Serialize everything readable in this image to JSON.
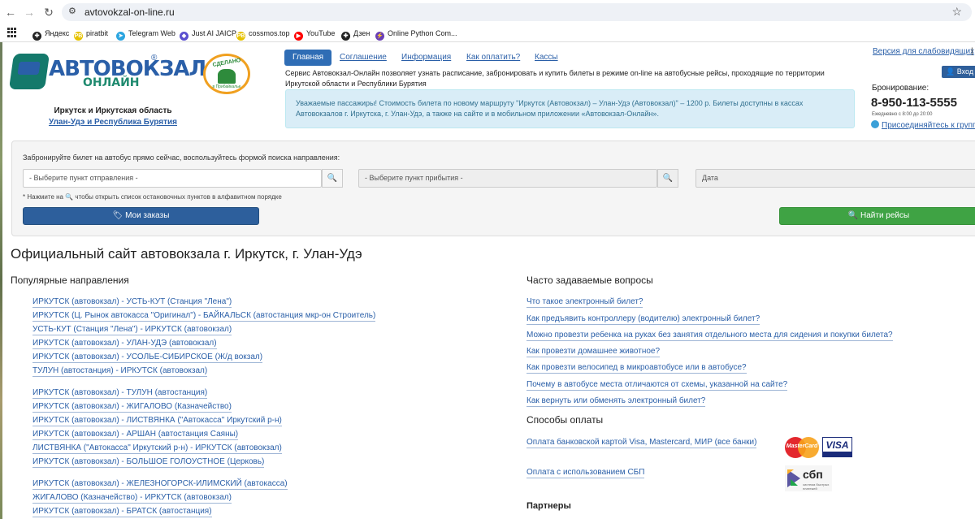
{
  "browser": {
    "url": "avtovokzal-on-line.ru",
    "bookmarks": [
      {
        "label": "Яндекс",
        "icon": "yandex-icon",
        "color": "#222222",
        "glyph": "✚"
      },
      {
        "label": "piratbit",
        "icon": "piratbit-icon",
        "color": "#e6c200",
        "glyph": "PB"
      },
      {
        "label": "Telegram Web",
        "icon": "telegram-icon",
        "color": "#2ca5e0",
        "glyph": "➤"
      },
      {
        "label": "Just AI JAICP",
        "icon": "jaicp-icon",
        "color": "#5a4fcf",
        "glyph": "◆"
      },
      {
        "label": "cossmos.top",
        "icon": "cossmos-icon",
        "color": "#e6c200",
        "glyph": "PB"
      },
      {
        "label": "YouTube",
        "icon": "youtube-icon",
        "color": "#ff0000",
        "glyph": "▶"
      },
      {
        "label": "Дзен",
        "icon": "dzen-icon",
        "color": "#222222",
        "glyph": "✚"
      },
      {
        "label": "Online Python Com...",
        "icon": "python-icon",
        "color": "#6a3fb5",
        "glyph": "⚡"
      }
    ]
  },
  "header": {
    "logo_line1": "АВТОВОКЗАЛ",
    "logo_line2": "ОНЛАЙН",
    "logo_reg": "®",
    "region_title": "Иркутск и Иркутская область",
    "region_link": "Улан-Удэ и Республика Бурятия",
    "badge_top": "СДЕЛАНО",
    "badge_bottom": "в Прибайкалье",
    "tabs": [
      "Главная",
      "Соглашение",
      "Информация",
      "Как оплатить?",
      "Кассы"
    ],
    "intro": "Сервис Автовокзал-Онлайн позволяет узнать расписание, забронировать и купить билеты в режиме on-line на автобусные рейсы, проходящие по территории Иркутской области и Республики Бурятия",
    "notice": "Уважаемые пассажиры! Стоимость билета по новому маршруту \"Иркутск (Автовокзал) – Улан-Удэ (Автовокзал)\" – 1200 р. Билеты доступны в кассах Автовокзалов г. Иркутска, г. Улан-Удэ, а также на сайте и в мобильном приложении «Автовокзал-Онлайн».",
    "low_vision_link": "Версия для слабовидящих",
    "separator": "|",
    "login": "Вход д",
    "booking_label": "Бронирование:",
    "phone": "8-950-113-5555",
    "hours": "Ежедневно с 8:00 до 20:00",
    "join_link": "Присоединяйтесь к группе"
  },
  "search": {
    "hint": "Забронируйте билет на автобус прямо сейчас, воспользуйтесь формой поиска направления:",
    "from_placeholder": "- Выберите пункт отправления -",
    "to_placeholder": "- Выберите пункт прибытия -",
    "date_placeholder": "Дата",
    "note": "* Нажмите на 🔍 чтобы открыть список остановочных пунктов в алфавитном порядке",
    "orders_button": "🏷 Мои заказы",
    "find_button": "🔍 Найти рейсы"
  },
  "main": {
    "title": "Официальный сайт автовокзала г. Иркутск, г. Улан-Удэ",
    "popular_heading": "Популярные направления",
    "routes": [
      "ИРКУТСК (автовокзал) - УСТЬ-КУТ (Станция \"Лена\")",
      "ИРКУТСК (Ц. Рынок автокасса \"Оригинал\") - БАЙКАЛЬСК (автостанция мкр-он Строитель)",
      "УСТЬ-КУТ (Станция \"Лена\") - ИРКУТСК (автовокзал)",
      "ИРКУТСК (автовокзал) - УЛАН-УДЭ (автовокзал)",
      "ИРКУТСК (автовокзал) - УСОЛЬЕ-СИБИРСКОЕ (Ж/д вокзал)",
      "ТУЛУН (автостанция) - ИРКУТСК (автовокзал)",
      "ИРКУТСК (автовокзал) - ТУЛУН (автостанция)",
      "ИРКУТСК (автовокзал) - ЖИГАЛОВО (Казначейство)",
      "ИРКУТСК (автовокзал) - ЛИСТВЯНКА (\"Автокасса\" Иркутский р-н)",
      "ИРКУТСК (автовокзал) - АРШАН (автостанция Саяны)",
      "ЛИСТВЯНКА (\"Автокасса\" Иркутский р-н) - ИРКУТСК (автовокзал)",
      "ИРКУТСК (автовокзал) - БОЛЬШОЕ ГОЛОУСТНОЕ (Церковь)",
      "ИРКУТСК (автовокзал) - ЖЕЛЕЗНОГОРСК-ИЛИМСКИЙ (автокасса)",
      "ЖИГАЛОВО (Казначейство) - ИРКУТСК (автовокзал)",
      "ИРКУТСК (автовокзал) - БРАТСК (автостанция)"
    ],
    "faq_heading": "Часто задаваемые вопросы",
    "faq": [
      "Что такое электронный билет?",
      "Как предъявить контроллеру (водителю) электронный билет?",
      "Можно провезти ребенка на руках без занятия отдельного места для сидения и покупки билета?",
      "Как провезти домашнее животное?",
      "Как провезти велосипед в микроавтобусе или в автобусе?",
      "Почему в автобусе места отличаются от схемы, указанной на сайте?",
      "Как вернуть или обменять электронный билет?"
    ],
    "payment_heading": "Способы оплаты",
    "payment_card": "Оплата банковской картой Visa, Mastercard, МИР (все банки)",
    "payment_sbp": "Оплата с использованием СБП",
    "mastercard_text": "MasterCard",
    "visa_text": "VISA",
    "sbp_text": "сбп",
    "sbp_sub": "система быстрых платежей",
    "partners_heading": "Партнеры"
  }
}
